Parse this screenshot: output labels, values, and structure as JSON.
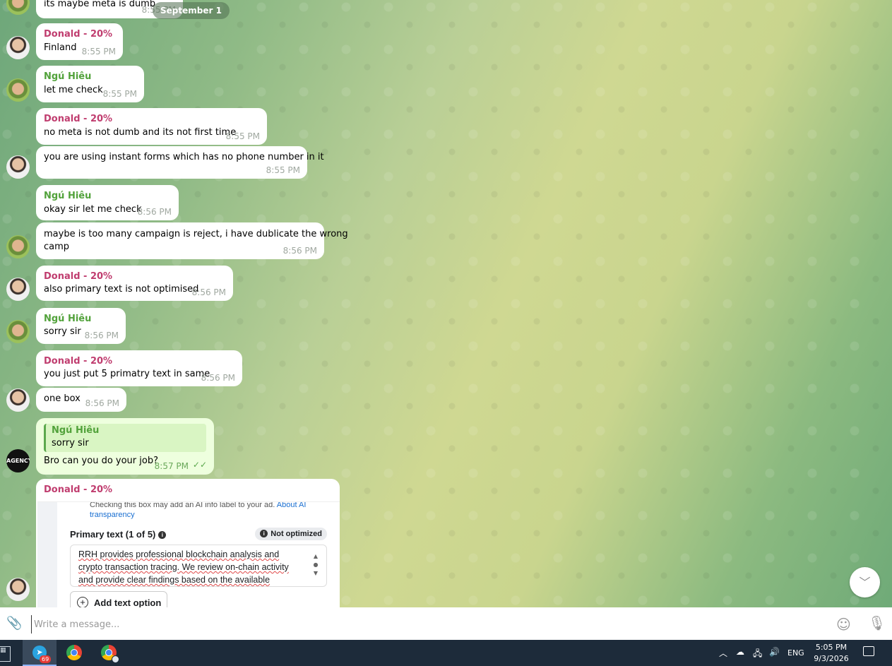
{
  "chat": {
    "date_pill": "September 1",
    "partial_message": {
      "text": "its maybe meta is dumb",
      "time": "8:55 PM"
    },
    "messages": [
      {
        "sender": "Donald - 20%",
        "text": "Finland",
        "time": "8:55 PM"
      },
      {
        "sender": "Ngú Hiêu",
        "text": "let me check",
        "time": "8:55 PM"
      },
      {
        "sender": "Donald - 20%",
        "text": "no meta is not dumb and its not first time",
        "time": "8:55 PM"
      },
      {
        "text": "you are using instant forms which has no phone number in it",
        "time": "8:55 PM"
      },
      {
        "sender": "Ngú Hiêu",
        "text": "okay sir let me check",
        "time": "8:56 PM"
      },
      {
        "text_line1": "maybe is too many campaign is reject, i have dublicate the wrong",
        "text_line2": "camp",
        "time": "8:56 PM"
      },
      {
        "sender": "Donald - 20%",
        "text": "also primary text is not optimised",
        "time": "8:56 PM"
      },
      {
        "sender": "Ngú Hiêu",
        "text": "sorry sir",
        "time": "8:56 PM"
      },
      {
        "sender": "Donald - 20%",
        "text": "you just put 5 primatry text in same",
        "time": "8:56 PM"
      },
      {
        "text": "one box",
        "time": "8:56 PM"
      },
      {
        "reply_to_name": "Ngú Hiêu",
        "reply_to_text": "sorry sir",
        "text": "Bro can you do your job?",
        "time": "8:57 PM",
        "status": "✓✓"
      },
      {
        "sender": "Donald - 20%"
      }
    ],
    "avatar_me_label": "AGENCY",
    "screenshot": {
      "line1_text": "Checking this box may add an AI info label to your ad.",
      "line1_link": "About AI",
      "line2_link": "transparency",
      "primary_text_label": "Primary text (1 of 5)",
      "badge": "Not optimized",
      "body_line1": "RRH provides professional blockchain analysis and",
      "body_line2": "crypto transaction tracing. We review on-chain activity",
      "body_line3": "and provide clear findings based on the available",
      "add_option": "Add text option"
    }
  },
  "composer": {
    "placeholder": "Write a message..."
  },
  "taskbar": {
    "telegram_badge": "69",
    "language": "ENG",
    "time": "5:05 PM",
    "date": "9/3/2026"
  },
  "colors": {
    "donald": "#c03d6f",
    "ngu": "#52a23b",
    "outgoing_bubble": "#eeffde",
    "taskbar": "#1d2b3a"
  },
  "icons": [
    "paperclip-icon",
    "emoji-icon",
    "microphone-icon",
    "chevron-down-icon",
    "telegram-icon",
    "chrome-icon",
    "calculator-icon",
    "read-receipt-icon",
    "info-icon",
    "plus-icon",
    "notification-icon",
    "speaker-icon",
    "network-icon",
    "tray-arrow-icon"
  ]
}
